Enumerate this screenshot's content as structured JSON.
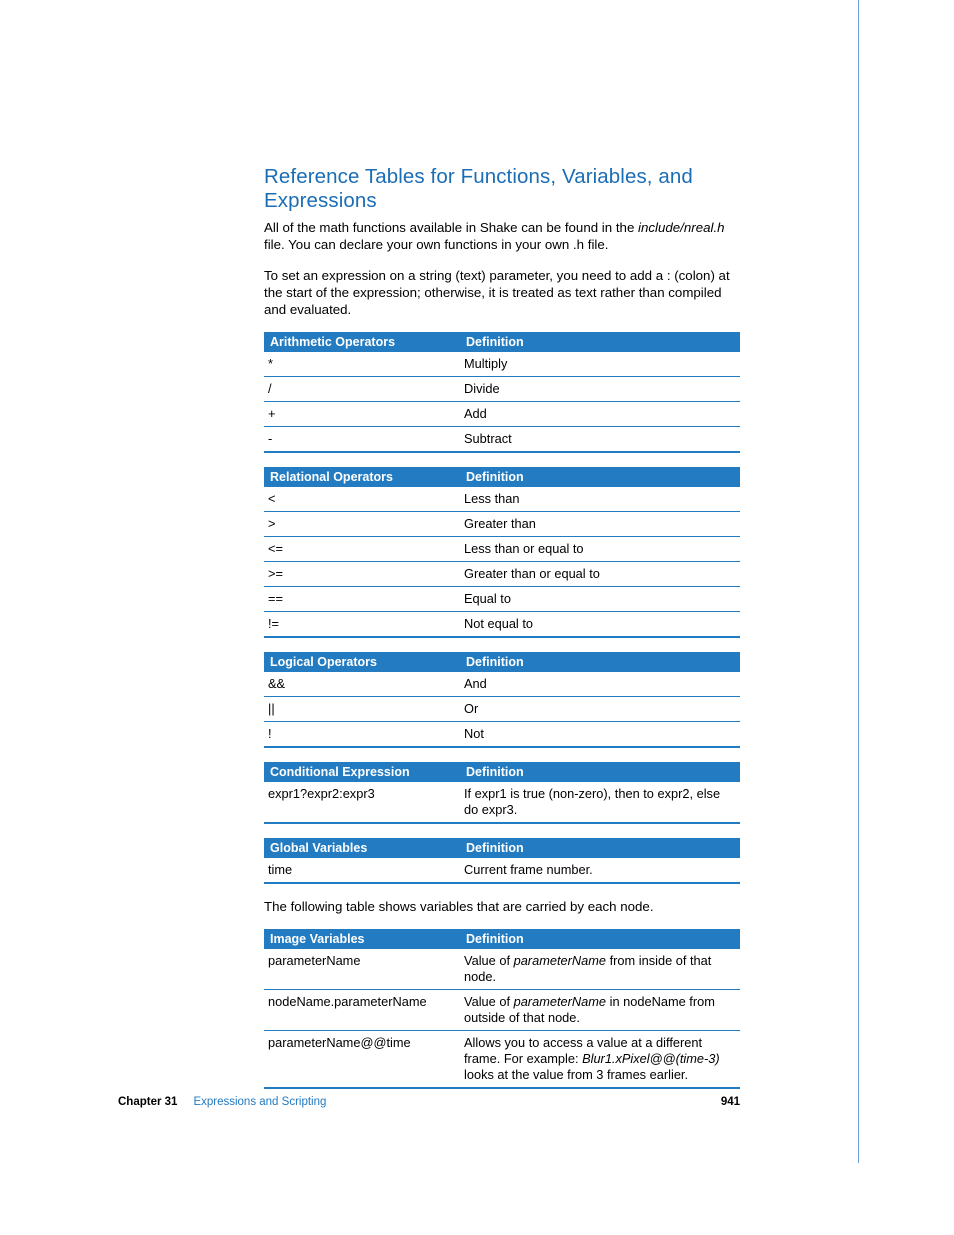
{
  "title": "Reference Tables for Functions, Variables, and Expressions",
  "para1_a": "All of the math functions available in Shake can be found in the ",
  "para1_i": "include/nreal.h",
  "para1_b": " file. You can declare your own functions in your own .h file.",
  "para2": "To set an expression on a string (text) parameter, you need to add a : (colon) at the start of the expression; otherwise, it is treated as text rather than compiled and evaluated.",
  "tables": {
    "arith": {
      "h1": "Arithmetic Operators",
      "h2": "Definition",
      "rows": [
        {
          "a": "*",
          "b": "Multiply"
        },
        {
          "a": "/",
          "b": "Divide"
        },
        {
          "a": "+",
          "b": "Add"
        },
        {
          "a": "-",
          "b": "Subtract"
        }
      ]
    },
    "rel": {
      "h1": "Relational Operators",
      "h2": "Definition",
      "rows": [
        {
          "a": "<",
          "b": "Less than"
        },
        {
          "a": ">",
          "b": "Greater than"
        },
        {
          "a": "<=",
          "b": "Less than or equal to"
        },
        {
          "a": ">=",
          "b": "Greater than or equal to"
        },
        {
          "a": "==",
          "b": "Equal to"
        },
        {
          "a": "!=",
          "b": "Not equal to"
        }
      ]
    },
    "logic": {
      "h1": "Logical Operators",
      "h2": "Definition",
      "rows": [
        {
          "a": "&&",
          "b": "And"
        },
        {
          "a": "||",
          "b": "Or"
        },
        {
          "a": "!",
          "b": "Not"
        }
      ]
    },
    "cond": {
      "h1": "Conditional Expression",
      "h2": "Definition",
      "rows": [
        {
          "a": "expr1?expr2:expr3",
          "b": "If expr1 is true (non-zero), then to expr2, else do expr3."
        }
      ]
    },
    "global": {
      "h1": "Global Variables",
      "h2": "Definition",
      "rows": [
        {
          "a": "time",
          "b": "Current frame number."
        }
      ]
    },
    "image": {
      "h1": "Image Variables",
      "h2": "Definition",
      "rows": [
        {
          "a": "parameterName",
          "pre": "Value of ",
          "i": "parameterName",
          "post": " from inside of that node."
        },
        {
          "a": "nodeName.parameterName",
          "pre": "Value of ",
          "i": "parameterName",
          "post": " in nodeName from outside of that node."
        },
        {
          "a": "parameterName@@time",
          "pre": "Allows you to access a value at a different frame. For example: ",
          "i": "Blur1.xPixel@@(time-3)",
          "post": " looks at the value from 3 frames earlier."
        }
      ]
    }
  },
  "para3": "The following table shows variables that are carried by each node.",
  "footer": {
    "chapter_label": "Chapter 31",
    "chapter_title": "Expressions and Scripting",
    "page": "941"
  }
}
